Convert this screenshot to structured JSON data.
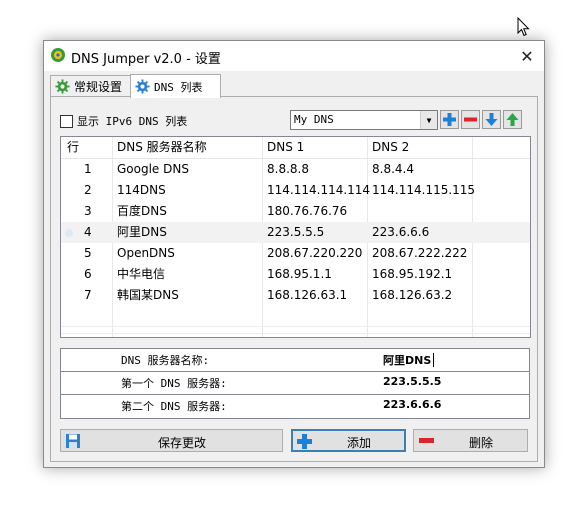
{
  "window": {
    "title": "DNS Jumper v2.0 - 设置",
    "close_glyph": "✕"
  },
  "tabs": [
    {
      "label": "常规设置",
      "icon": "gear-green-icon"
    },
    {
      "label": "DNS 列表",
      "icon": "gear-blue-icon"
    }
  ],
  "toolbar": {
    "ipv6_label": "显示 IPv6 DNS 列表",
    "ipv6_checked": false,
    "combo_value": "My DNS",
    "buttons": [
      "add-icon",
      "remove-icon",
      "move-down-icon",
      "move-up-icon"
    ]
  },
  "table": {
    "headers": [
      "行",
      "DNS 服务器名称",
      "DNS 1",
      "DNS 2"
    ],
    "rows": [
      {
        "num": "1",
        "name": "Google DNS",
        "dns1": "8.8.8.8",
        "dns2": "8.8.4.4"
      },
      {
        "num": "2",
        "name": "114DNS",
        "dns1": "114.114.114.114",
        "dns2": "114.114.115.115"
      },
      {
        "num": "3",
        "name": "百度DNS",
        "dns1": "180.76.76.76",
        "dns2": ""
      },
      {
        "num": "4",
        "name": "阿里DNS",
        "dns1": "223.5.5.5",
        "dns2": "223.6.6.6"
      },
      {
        "num": "5",
        "name": "OpenDNS",
        "dns1": "208.67.220.220",
        "dns2": "208.67.222.222"
      },
      {
        "num": "6",
        "name": "中华电信",
        "dns1": "168.95.1.1",
        "dns2": "168.95.192.1"
      },
      {
        "num": "7",
        "name": "韩国某DNS",
        "dns1": "168.126.63.1",
        "dns2": "168.126.63.2"
      }
    ],
    "selected_index": 3
  },
  "details": {
    "name_label": "DNS 服务器名称:",
    "name_value": "阿里DNS",
    "primary_label": "第一个 DNS 服务器:",
    "primary_value": "223.5.5.5",
    "secondary_label": "第二个 DNS 服务器:",
    "secondary_value": "223.6.6.6"
  },
  "actions": {
    "save_label": "保存更改",
    "add_label": "添加",
    "delete_label": "删除"
  },
  "colors": {
    "accent_blue": "#1e7fd6",
    "delete_red": "#d9252b",
    "up_green": "#28a745"
  }
}
